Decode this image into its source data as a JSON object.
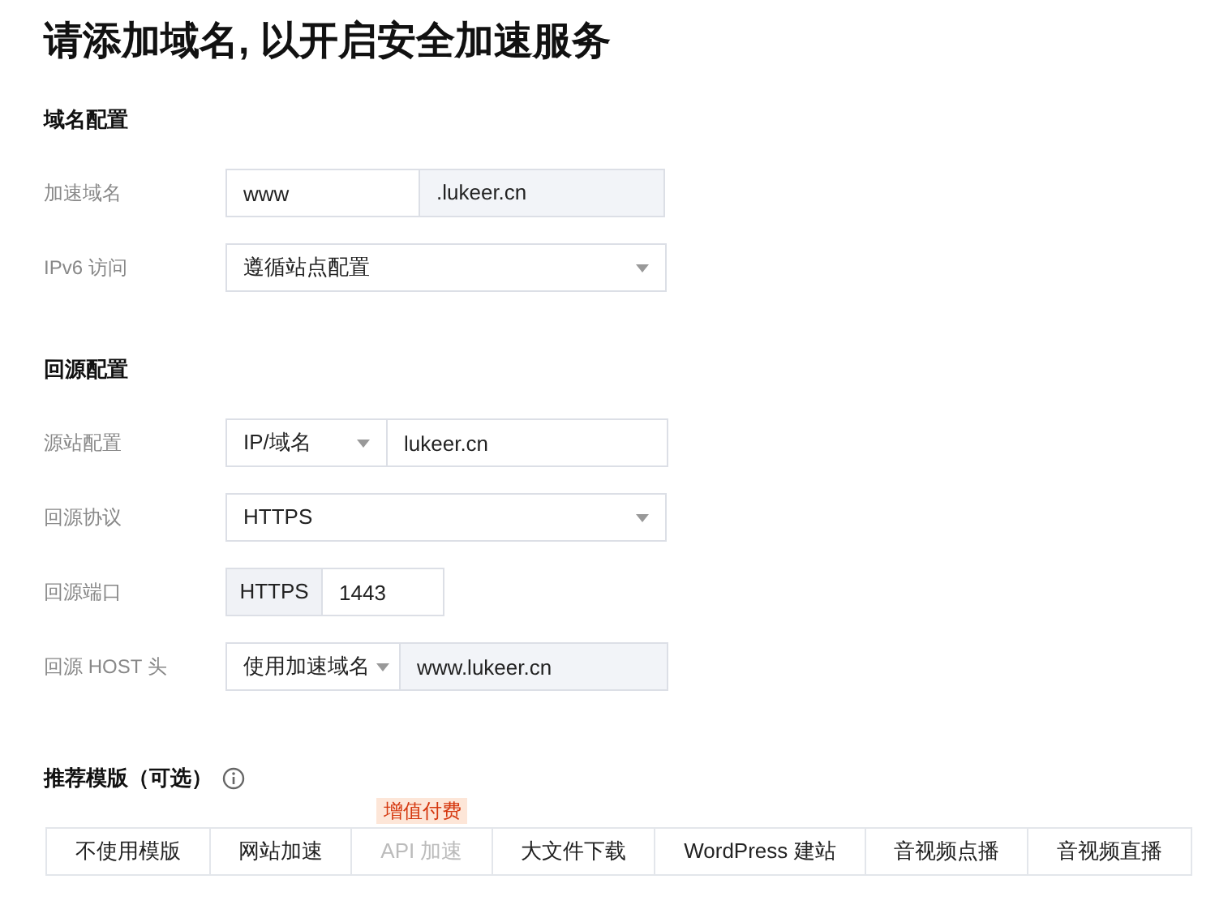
{
  "title": "请添加域名, 以开启安全加速服务",
  "sections": [
    {
      "heading": "域名配置",
      "rows": [
        {
          "label": "加速域名",
          "kind": "split",
          "value": "www",
          "suffix": ".lukeer.cn"
        },
        {
          "label": "IPv6 访问",
          "kind": "select",
          "value": "遵循站点配置"
        }
      ]
    },
    {
      "heading": "回源配置",
      "rows": [
        {
          "label": "源站配置",
          "kind": "select_input",
          "option": "IP/域名",
          "value": "lukeer.cn",
          "readonly": false
        },
        {
          "label": "回源协议",
          "kind": "select",
          "value": "HTTPS"
        },
        {
          "label": "回源端口",
          "kind": "addon_input",
          "addon": "HTTPS",
          "value": "1443"
        },
        {
          "label": "回源 HOST 头",
          "kind": "select_input",
          "option": "使用加速域名",
          "value": "www.lukeer.cn",
          "readonly": true
        }
      ]
    }
  ],
  "templates": {
    "heading": "推荐模版（可选）",
    "items": [
      {
        "label": "不使用模版",
        "disabled": false
      },
      {
        "label": "网站加速",
        "disabled": false
      },
      {
        "label": "API 加速",
        "disabled": true,
        "badge": "增值付费"
      },
      {
        "label": "大文件下载",
        "disabled": false
      },
      {
        "label": "WordPress 建站",
        "disabled": false
      },
      {
        "label": "音视频点播",
        "disabled": false
      },
      {
        "label": "音视频直播",
        "disabled": false
      }
    ]
  }
}
